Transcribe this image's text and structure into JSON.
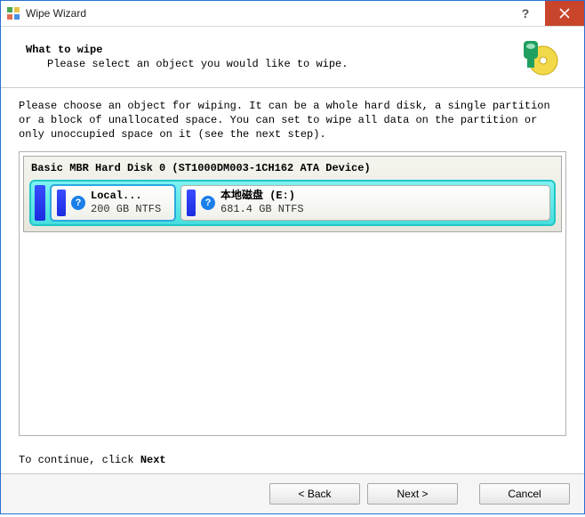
{
  "titlebar": {
    "title": "Wipe Wizard"
  },
  "header": {
    "title": "What to wipe",
    "subtitle": "Please select an object you would like to wipe."
  },
  "description": "Please choose an object for wiping. It can be a whole hard disk, a single partition or a block of unallocated space. You can set to wipe all data on the partition or only unoccupied space on it (see the next step).",
  "disk": {
    "title": "Basic MBR Hard Disk 0 (ST1000DM003-1CH162 ATA Device)",
    "partitions": [
      {
        "name": "Local...",
        "size": "200 GB NTFS"
      },
      {
        "name": "本地磁盘 (E:)",
        "size": "681.4 GB NTFS"
      }
    ]
  },
  "continue_prefix": "To continue, click ",
  "continue_bold": "Next",
  "buttons": {
    "back": "< Back",
    "next": "Next >",
    "cancel": "Cancel"
  }
}
